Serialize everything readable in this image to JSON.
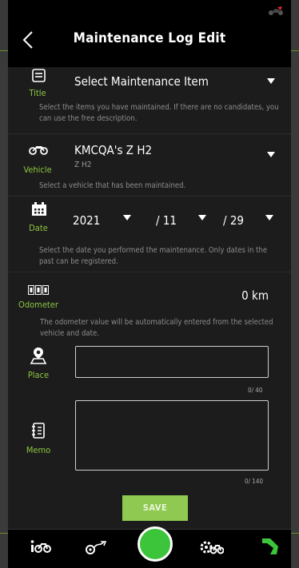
{
  "header": {
    "title": "Maintenance Log Edit"
  },
  "title_field": {
    "label": "Title",
    "value": "Select Maintenance Item",
    "help": "Select the items you have maintained. If there are no candidates, you can use the free description."
  },
  "vehicle_field": {
    "label": "Vehicle",
    "value": "KMCQA's Z H2",
    "sub_value": "Z H2",
    "help": "Select a vehicle that has been maintained."
  },
  "date_field": {
    "label": "Date",
    "year": "2021",
    "month": "/ 11",
    "day": "/ 29",
    "help": "Select the date you performed the maintenance. Only dates in the past can be registered."
  },
  "odometer_field": {
    "label": "Odometer",
    "value": "0 km",
    "help": "The odometer value will be automatically entered from the selected vehicle and date."
  },
  "place_field": {
    "label": "Place",
    "value": "",
    "counter": "0/ 40"
  },
  "memo_field": {
    "label": "Memo",
    "value": "",
    "counter": "0/ 140"
  },
  "save_label": "SAVE",
  "colors": {
    "accent": "#8cc63f",
    "save": "#8fc952",
    "center_button": "#3cc43a"
  },
  "icons": {
    "back": "chevron-left-icon",
    "title": "list-icon",
    "vehicle": "motorcycle-icon",
    "date": "calendar-icon",
    "odometer": "odometer-icon",
    "place": "map-pin-icon",
    "memo": "notebook-icon"
  },
  "tabs": [
    "bike-info-tab",
    "route-tab",
    "home-tab",
    "maintenance-tab",
    "kawasaki-tab"
  ]
}
